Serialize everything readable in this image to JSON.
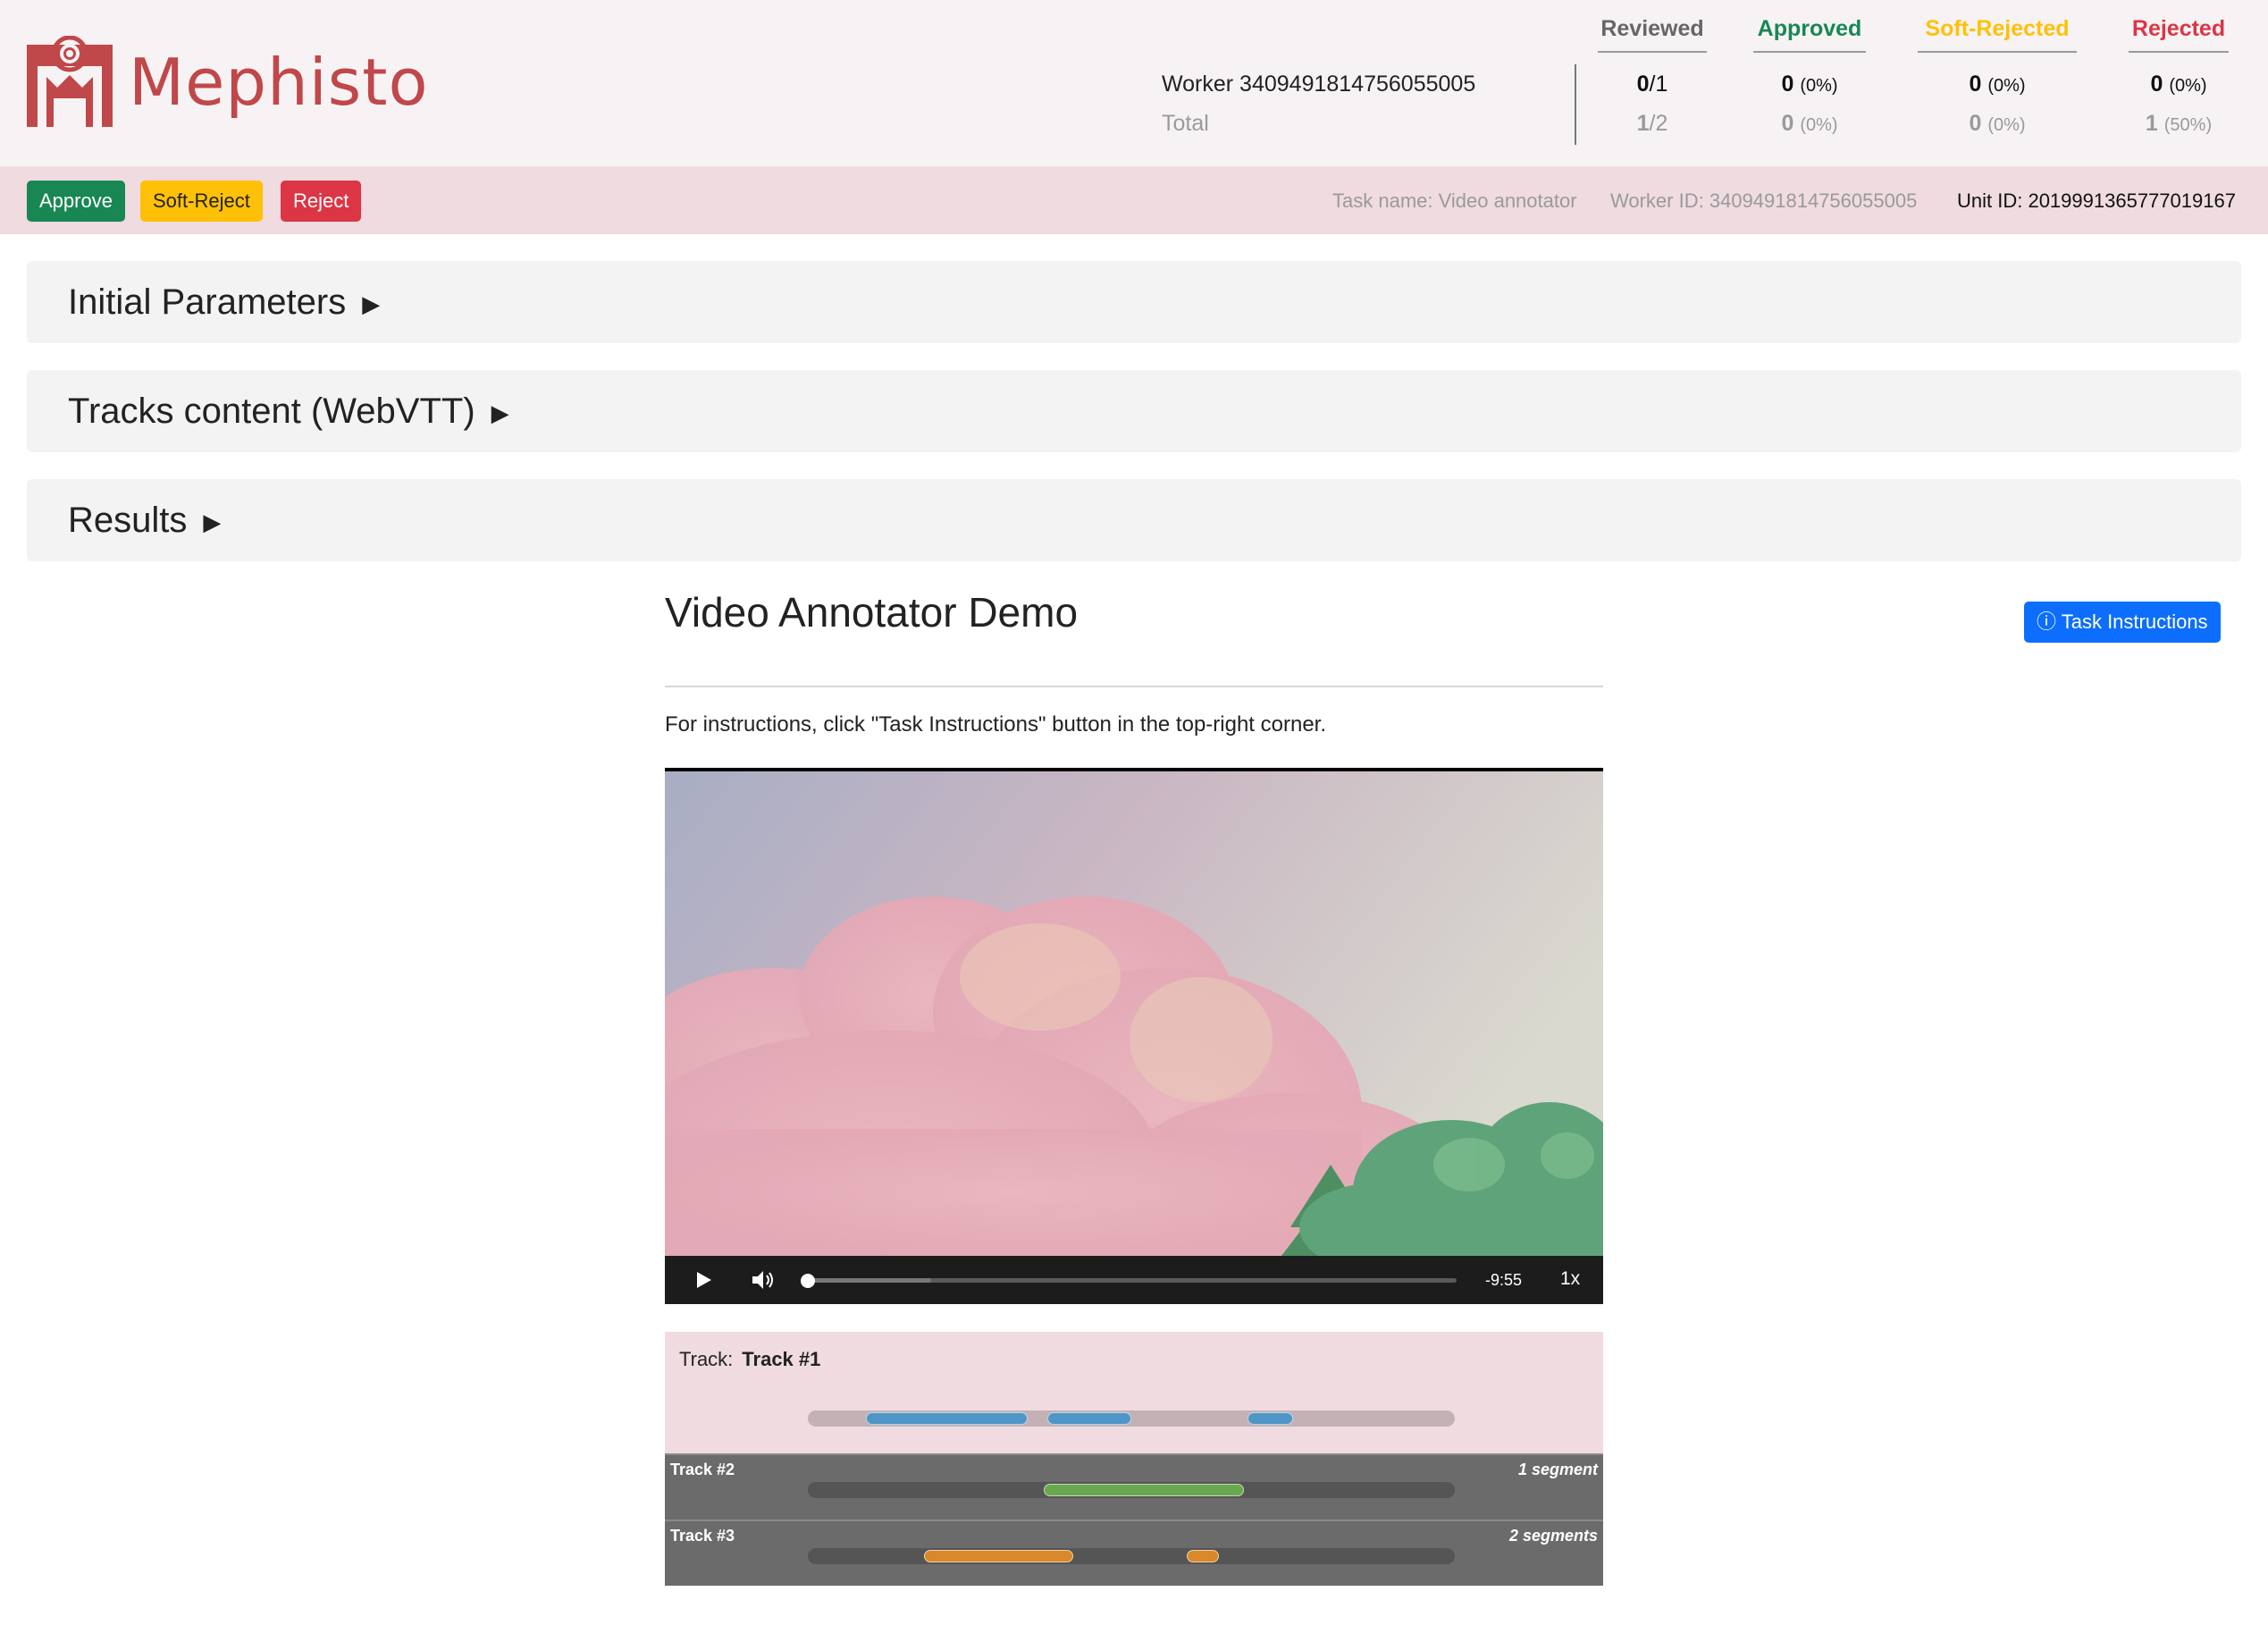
{
  "brand": {
    "name": "Mephisto",
    "logo_icon": "mephisto-logo-icon",
    "color": "#c0474a"
  },
  "stats": {
    "worker_label": "Worker 3409491814756055005",
    "total_label": "Total",
    "columns": [
      {
        "header": "Reviewed",
        "color": "#666666",
        "worker_bold": "0",
        "worker_rest": "/1",
        "worker_pct": "",
        "total_bold": "1",
        "total_rest": "/2",
        "total_pct": ""
      },
      {
        "header": "Approved",
        "color": "#198754",
        "worker_bold": "0",
        "worker_rest": "",
        "worker_pct": "(0%)",
        "total_bold": "0",
        "total_rest": "",
        "total_pct": "(0%)"
      },
      {
        "header": "Soft-Rejected",
        "color": "#ffc107",
        "worker_bold": "0",
        "worker_rest": "",
        "worker_pct": "(0%)",
        "total_bold": "0",
        "total_rest": "",
        "total_pct": "(0%)"
      },
      {
        "header": "Rejected",
        "color": "#dc3545",
        "worker_bold": "0",
        "worker_rest": "",
        "worker_pct": "(0%)",
        "total_bold": "1",
        "total_rest": "",
        "total_pct": "(50%)"
      }
    ]
  },
  "actions": {
    "approve": "Approve",
    "soft_reject": "Soft-Reject",
    "reject": "Reject"
  },
  "meta": {
    "task_name": "Task name: Video annotator",
    "worker_id": "Worker ID: 3409491814756055005",
    "unit_id": "Unit ID: 2019991365777019167"
  },
  "panels": [
    {
      "title": "Initial Parameters",
      "arrow": "▶"
    },
    {
      "title": "Tracks content (WebVTT)",
      "arrow": "▶"
    },
    {
      "title": "Results",
      "arrow": "▶"
    }
  ],
  "task": {
    "title": "Video Annotator Demo",
    "instructions_button": "ⓘ Task Instructions",
    "instructions_text": "For instructions, click \"Task Instructions\" button in the top-right corner."
  },
  "player": {
    "time_remaining": "-9:55",
    "speed": "1x",
    "progress": 0.0,
    "buffered": 0.19,
    "play_icon": "play-icon",
    "volume_icon": "volume-icon"
  },
  "tracks": [
    {
      "label": "Track:",
      "name": "Track #1",
      "count": "",
      "color": "#4f96c6",
      "segments": [
        [
          0.09,
          0.34
        ],
        [
          0.37,
          0.5
        ],
        [
          0.68,
          0.75
        ]
      ]
    },
    {
      "label": "",
      "name": "Track #2",
      "count": "1 segment",
      "color": "#6aa84f",
      "segments": [
        [
          0.365,
          0.675
        ]
      ]
    },
    {
      "label": "",
      "name": "Track #3",
      "count": "2 segments",
      "color": "#d9882a",
      "segments": [
        [
          0.18,
          0.41
        ],
        [
          0.585,
          0.635
        ]
      ]
    }
  ]
}
